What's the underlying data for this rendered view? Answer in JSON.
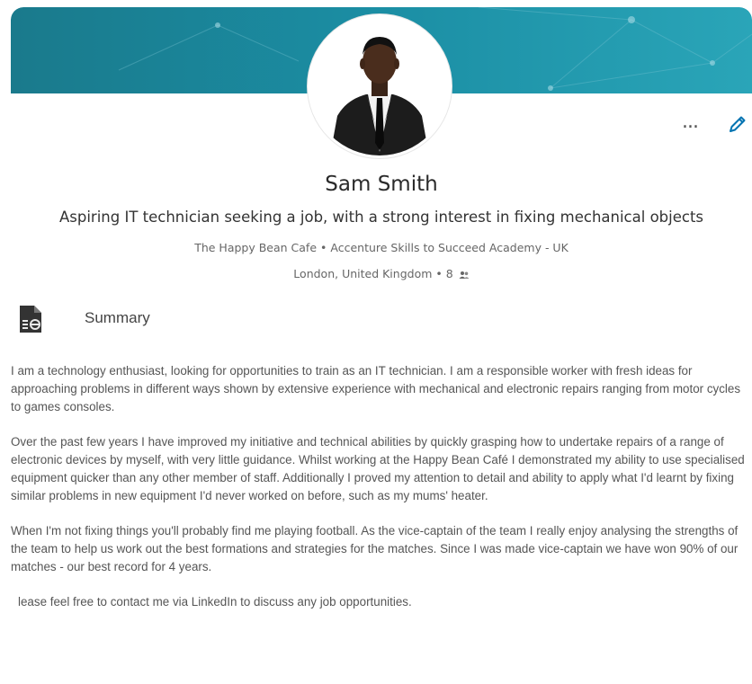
{
  "profile": {
    "name": "Sam Smith",
    "headline": "Aspiring IT technician seeking a job, with a strong interest in fixing mechanical objects",
    "current_company": "The Happy Bean Cafe",
    "education": "Accenture Skills to Succeed Academy - UK",
    "separator": "•",
    "location": "London, United Kingdom",
    "connections": "8"
  },
  "actions": {
    "more_label": "...",
    "edit_icon": "pencil-icon"
  },
  "summary": {
    "title": "Summary",
    "icon": "document-icon",
    "paragraphs": [
      "I am a technology enthusiast, looking for opportunities to train as an IT technician. I am a responsible worker with fresh ideas for approaching problems in different ways shown by extensive experience with mechanical and electronic repairs ranging from motor cycles to games consoles.",
      "Over the past few years I have improved my initiative and technical abilities by quickly grasping how to undertake repairs of a range of electronic devices by myself, with very little guidance. Whilst working at the Happy Bean Café I demonstrated my ability to use specialised equipment quicker than any other member of staff. Additionally I proved my attention to detail and ability to apply what I'd learnt by fixing similar problems in new equipment I'd never worked on before, such as my mums' heater.",
      "When I'm not fixing things you'll probably find me playing football. As the vice-captain of the team I really enjoy analysing the strengths of the team to help us work out the best formations and strategies for the matches. Since I was made vice-captain we have won 90% of our matches - our best record for 4 years.",
      "lease feel free to contact me via LinkedIn to discuss any job opportunities."
    ]
  },
  "colors": {
    "banner": "#1b8ea4",
    "accent": "#0073b1",
    "summary_icon": "#333333",
    "summary_icon_accent": "#e8e8e8"
  }
}
